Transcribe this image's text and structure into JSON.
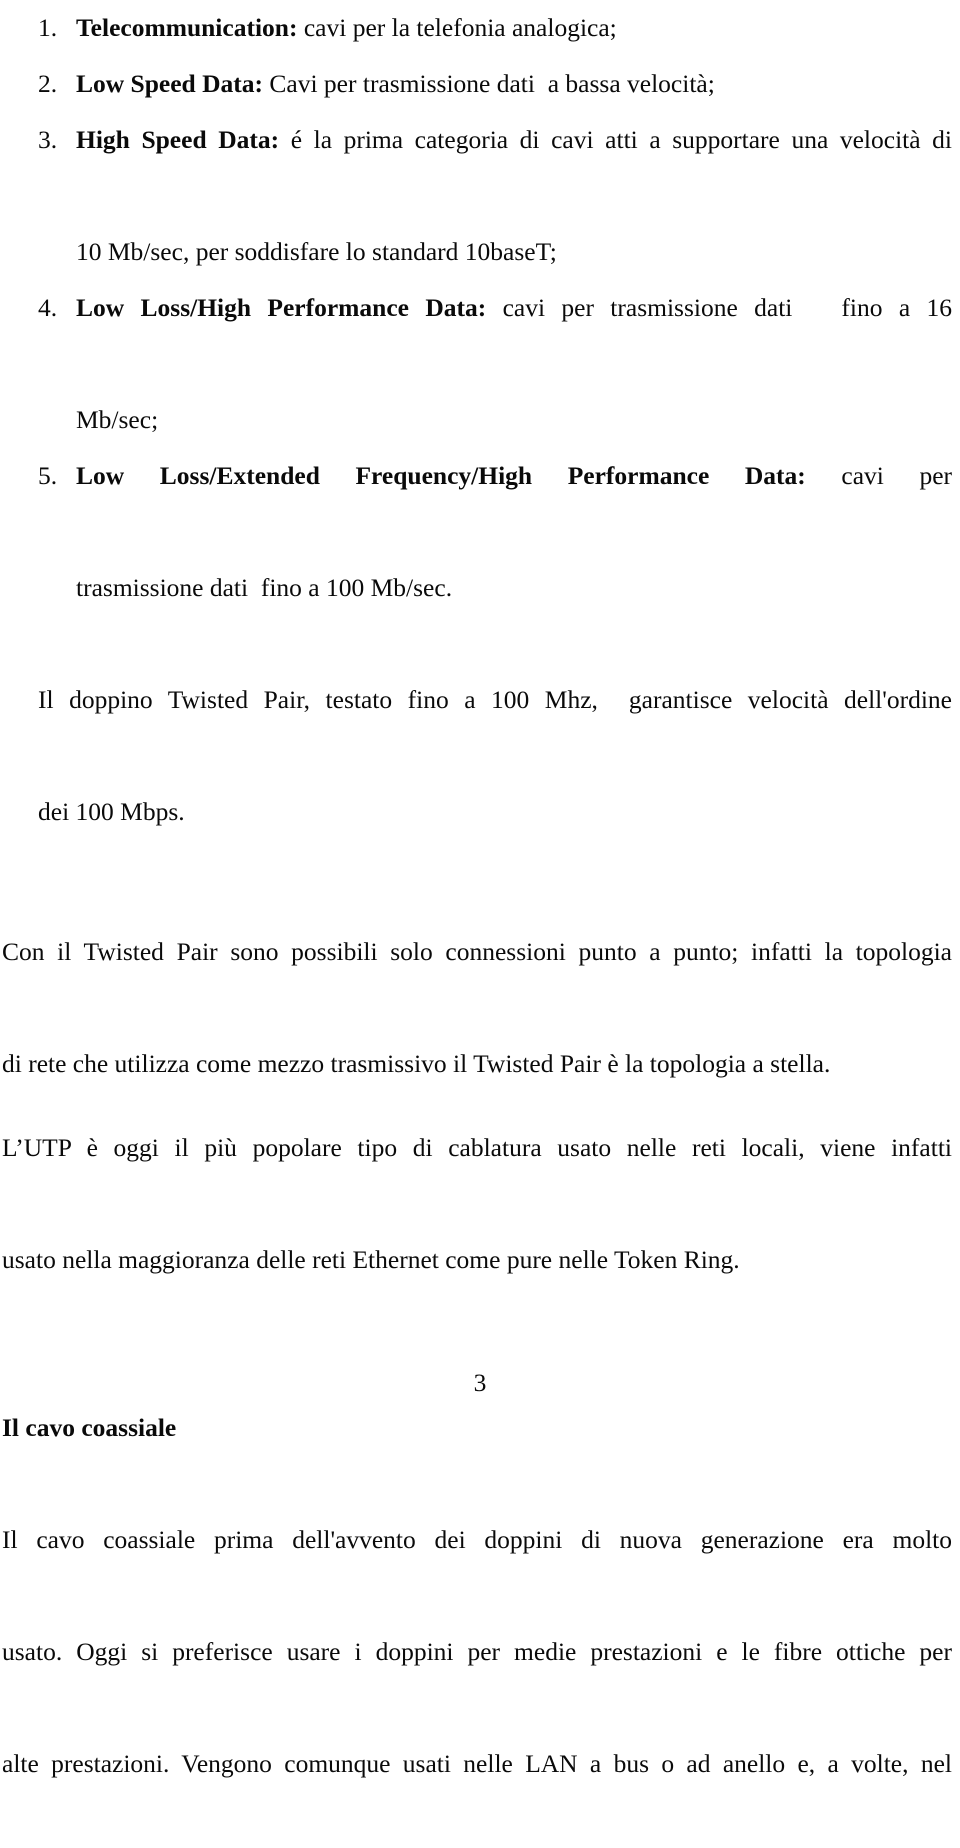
{
  "document": {
    "page_number": "3",
    "background_color": "#ffffff",
    "text_color": "#0a0a0a",
    "language": "it"
  },
  "list": {
    "items": [
      {
        "marker": "1.",
        "lead": "Telecommunication:",
        "lines": [
          {
            "text": "Telecommunication: cavi per la telefonia analogica;",
            "align": "left"
          }
        ]
      },
      {
        "marker": "2.",
        "lead": "Low Speed Data:",
        "lines": [
          {
            "text": "Low Speed Data: Cavi per trasmissione dati  a bassa velocità;",
            "align": "left"
          }
        ]
      },
      {
        "marker": "3.",
        "lead": "High Speed Data:",
        "lines": [
          {
            "text": "High Speed Data: é la prima categoria di cavi atti a supportare una velocità di",
            "align": "justify"
          },
          {
            "text": "10 Mb/sec, per soddisfare lo standard 10baseT;",
            "align": "left"
          }
        ]
      },
      {
        "marker": "4.",
        "lead": "Low Loss/High Performance Data:",
        "lines": [
          {
            "text": "Low Loss/High Performance Data: cavi per trasmissione dati   fino a 16",
            "align": "justify"
          },
          {
            "text": "Mb/sec;",
            "align": "left"
          }
        ]
      },
      {
        "marker": "5.",
        "lead": "Low Loss/Extended Frequency/High Performance Data:",
        "lines": [
          {
            "text": "Low Loss/Extended Frequency/High Performance Data: cavi per",
            "align": "justify"
          },
          {
            "text": "trasmissione dati  fino a 100 Mb/sec.",
            "align": "left"
          }
        ]
      }
    ]
  },
  "paragraphs": [
    {
      "id": "doppino",
      "indent": true,
      "lines": [
        {
          "text": "Il doppino Twisted Pair, testato fino a 100 Mhz,  garantisce velocità dell'ordine",
          "align": "justify"
        },
        {
          "text": "dei 100 Mbps.",
          "align": "left"
        }
      ]
    },
    {
      "id": "twisted-pair-topologia",
      "indent": false,
      "lines": [
        {
          "text": "Con il Twisted Pair sono possibili solo connessioni punto a punto; infatti la topologia",
          "align": "justify"
        },
        {
          "text": "di rete che utilizza come mezzo trasmissivo il Twisted Pair è la topologia a stella.",
          "align": "left"
        }
      ]
    },
    {
      "id": "utp",
      "indent": false,
      "lines": [
        {
          "text": "L’UTP è oggi il più popolare tipo di cablatura usato nelle reti locali, viene infatti",
          "align": "justify"
        },
        {
          "text": "usato nella maggioranza delle reti Ethernet come pure nelle Token Ring.",
          "align": "left"
        }
      ]
    }
  ],
  "section": {
    "heading": "Il cavo coassiale",
    "paragraph": {
      "id": "cavo-coassiale",
      "lines": [
        {
          "text": "Il cavo coassiale prima dell'avvento dei doppini di nuova generazione era molto",
          "align": "justify"
        },
        {
          "text": "usato. Oggi si preferisce usare i doppini per medie prestazioni e le fibre ottiche per",
          "align": "justify"
        },
        {
          "text": "alte prestazioni. Vengono comunque usati nelle LAN a bus o ad anello e, a volte, nel",
          "align": "justify"
        }
      ]
    }
  }
}
